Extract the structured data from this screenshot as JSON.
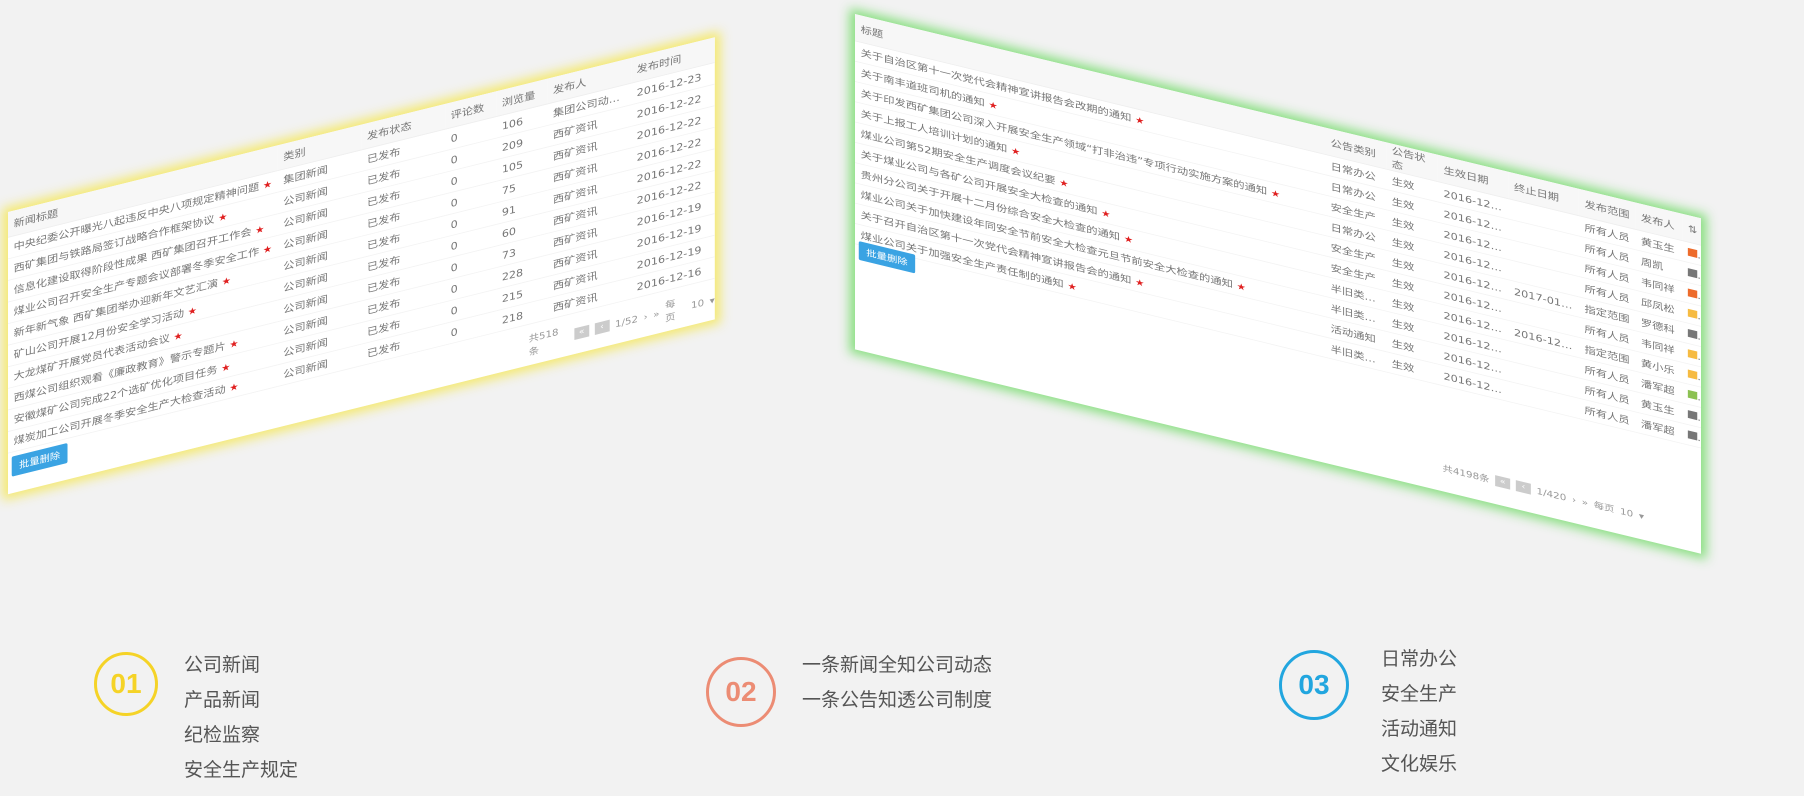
{
  "left_panel": {
    "headers": [
      "新闻标题",
      "类别",
      "发布状态",
      "评论数",
      "浏览量",
      "发布人",
      "发布时间"
    ],
    "rows": [
      {
        "title": "中央纪委公开曝光八起违反中央八项规定精神问题",
        "cat": "集团新闻",
        "status": "已发布",
        "comments": "0",
        "views": "106",
        "author": "集团公司动态办公...",
        "date": "2016-12-23",
        "color": "#8cc152"
      },
      {
        "title": "西矿集团与铁路局签订战略合作框架协议",
        "cat": "公司新闻",
        "status": "已发布",
        "comments": "0",
        "views": "209",
        "author": "西矿资讯",
        "date": "2016-12-22",
        "color": "#ed6b2b"
      },
      {
        "title": "信息化建设取得阶段性成果 西矿集团召开工作会",
        "cat": "公司新闻",
        "status": "已发布",
        "comments": "0",
        "views": "105",
        "author": "西矿资讯",
        "date": "2016-12-22",
        "color": "#ed6b2b"
      },
      {
        "title": "煤业公司召开安全生产专题会议部署冬季安全工作",
        "cat": "公司新闻",
        "status": "已发布",
        "comments": "0",
        "views": "75",
        "author": "西矿资讯",
        "date": "2016-12-22",
        "color": "#8cc152"
      },
      {
        "title": "新年新气象 西矿集团举办迎新年文艺汇演",
        "cat": "公司新闻",
        "status": "已发布",
        "comments": "0",
        "views": "91",
        "author": "西矿资讯",
        "date": "2016-12-22",
        "color": "#3aa3e3"
      },
      {
        "title": "矿山公司开展12月份安全学习活动",
        "cat": "公司新闻",
        "status": "已发布",
        "comments": "0",
        "views": "60",
        "author": "西矿资讯",
        "date": "2016-12-22",
        "color": "#ed6b2b"
      },
      {
        "title": "大龙煤矿开展党员代表活动会议",
        "cat": "公司新闻",
        "status": "已发布",
        "comments": "0",
        "views": "73",
        "author": "西矿资讯",
        "date": "2016-12-19",
        "color": "#f6bb42"
      },
      {
        "title": "西煤公司组织观看《廉政教育》警示专题片",
        "cat": "公司新闻",
        "status": "已发布",
        "comments": "0",
        "views": "228",
        "author": "西矿资讯",
        "date": "2016-12-19",
        "color": "#8cc152"
      },
      {
        "title": "安徽煤矿公司完成22个选矿优化项目任务",
        "cat": "公司新闻",
        "status": "已发布",
        "comments": "0",
        "views": "215",
        "author": "西矿资讯",
        "date": "2016-12-19",
        "color": "#3aa3e3"
      },
      {
        "title": "煤炭加工公司开展冬季安全生产大检查活动",
        "cat": "公司新闻",
        "status": "已发布",
        "comments": "0",
        "views": "218",
        "author": "西矿资讯",
        "date": "2016-12-16",
        "color": "#8cc152"
      }
    ],
    "batch_delete": "批量删除",
    "total_text": "共518条",
    "page_text": "1/52",
    "per_page_label": "每页",
    "per_page_value": "10"
  },
  "right_panel": {
    "headers": [
      "标题",
      "公告类别",
      "公告状态",
      "生效日期",
      "终止日期",
      "发布范围",
      "发布人"
    ],
    "rows": [
      {
        "title": "关于自治区第十一次党代会精神宣讲报告会改期的通知",
        "cat": "日常办公",
        "status": "生效",
        "start": "2016-12-23",
        "end": "",
        "scope": "所有人员",
        "author": "黄玉生",
        "color": "#ed6b2b"
      },
      {
        "title": "关于南丰道班司机的通知",
        "cat": "日常办公",
        "status": "生效",
        "start": "2016-12-23",
        "end": "",
        "scope": "所有人员",
        "author": "周凯",
        "color": "#777777"
      },
      {
        "title": "关于印发西矿集团公司深入开展安全生产领域“打非治违”专项行动实施方案的通知",
        "cat": "安全生产",
        "status": "生效",
        "start": "2016-12-23",
        "end": "",
        "scope": "所有人员",
        "author": "韦同祥",
        "color": "#ed6b2b"
      },
      {
        "title": "关于上报工人培训计划的通知",
        "cat": "日常办公",
        "status": "生效",
        "start": "2016-12-23",
        "end": "",
        "scope": "所有人员",
        "author": "邱凤松",
        "color": "#f6bb42"
      },
      {
        "title": "煤业公司第52期安全生产调度会议纪要",
        "cat": "安全生产",
        "status": "生效",
        "start": "2016-12-23",
        "end": "2017-01-05",
        "scope": "指定范围",
        "author": "罗德科",
        "color": "#777777"
      },
      {
        "title": "关于煤业公司与各矿公司开展安全大检查的通知",
        "cat": "安全生产",
        "status": "生效",
        "start": "2016-12-23",
        "end": "",
        "scope": "所有人员",
        "author": "韦同祥",
        "color": "#f6bb42"
      },
      {
        "title": "贵州分公司关于开展十二月份综合安全大检查的通知",
        "cat": "半旧类公告",
        "status": "生效",
        "start": "2016-12-22",
        "end": "2016-12-31",
        "scope": "指定范围",
        "author": "黄小乐",
        "color": "#f6bb42"
      },
      {
        "title": "煤业公司关于加快建设年同安全节前安全大检查元旦节前安全大检查的通知",
        "cat": "半旧类公告",
        "status": "生效",
        "start": "2016-12-22",
        "end": "",
        "scope": "所有人员",
        "author": "潘军超",
        "color": "#8cc152"
      },
      {
        "title": "关于召开自治区第十一次党代会精神宣讲报告会的通知",
        "cat": "活动通知",
        "status": "生效",
        "start": "2016-12-22",
        "end": "",
        "scope": "所有人员",
        "author": "黄玉生",
        "color": "#777777"
      },
      {
        "title": "煤业公司关于加强安全生产责任制的通知",
        "cat": "半旧类公告",
        "status": "生效",
        "start": "2016-12-22",
        "end": "",
        "scope": "所有人员",
        "author": "潘军超",
        "color": "#777777"
      }
    ],
    "batch_delete": "批量删除",
    "total_text": "共4198条",
    "page_text": "1/420",
    "per_page_label": "每页",
    "per_page_value": "10"
  },
  "features": [
    {
      "num": "01",
      "color": "#f5d327",
      "items": [
        "公司新闻",
        "产品新闻",
        "纪检监察",
        "安全生产规定"
      ]
    },
    {
      "num": "02",
      "color": "#ec8c74",
      "items": [
        "一条新闻全知公司动态",
        "一条公告知透公司制度"
      ]
    },
    {
      "num": "03",
      "color": "#22a6df",
      "items": [
        "日常办公",
        "安全生产",
        "活动通知",
        "文化娱乐"
      ]
    }
  ]
}
